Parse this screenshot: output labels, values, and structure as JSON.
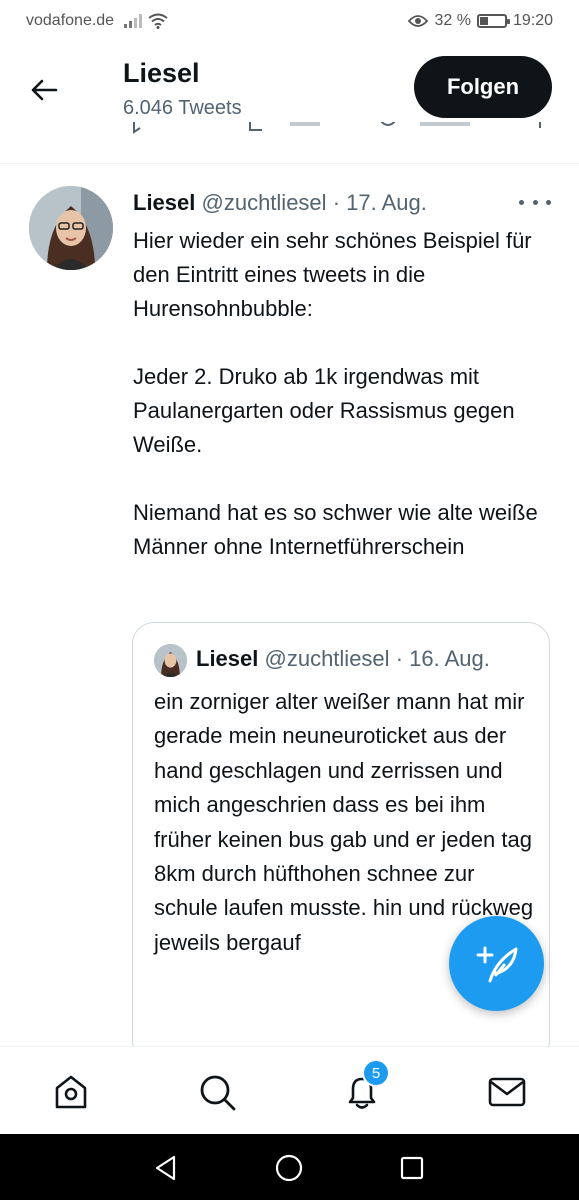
{
  "status_bar": {
    "carrier": "vodafone.de",
    "battery": "32 %",
    "battery_level": 0.32,
    "time": "19:20"
  },
  "header": {
    "name": "Liesel",
    "tweet_count": "6.046 Tweets",
    "follow_label": "Folgen"
  },
  "tweet": {
    "name": "Liesel",
    "handle": "@zuchtliesel",
    "separator": "·",
    "date": "17. Aug.",
    "paragraphs": [
      "Hier wieder ein sehr schönes Beispiel für den Eintritt eines tweets in die Hurensohnbubble:",
      "Jeder 2. Druko ab 1k irgendwas mit Paulanergarten oder Rassismus gegen Weiße.",
      "Niemand hat es so schwer wie alte weiße Männer ohne Internetführerschein"
    ]
  },
  "quote": {
    "name": "Liesel",
    "handle": "@zuchtliesel",
    "separator": "·",
    "date": "16. Aug.",
    "text": "ein zorniger alter weißer mann hat mir gerade mein neuneuroticket aus der hand geschlagen und zerrissen und mich angeschrien dass es bei ihm früher keinen bus gab und er jeden tag 8km durch hüfthohen schnee zur schule laufen musste. hin und rückweg jeweils bergauf"
  },
  "bottom_nav": {
    "items": [
      "home-icon",
      "search-icon",
      "bell-icon",
      "mail-icon"
    ],
    "notification_badge": "5"
  },
  "colors": {
    "accent": "#1d9bf0",
    "text": "#0f1419",
    "muted": "#536471",
    "border": "#cfd9de"
  }
}
